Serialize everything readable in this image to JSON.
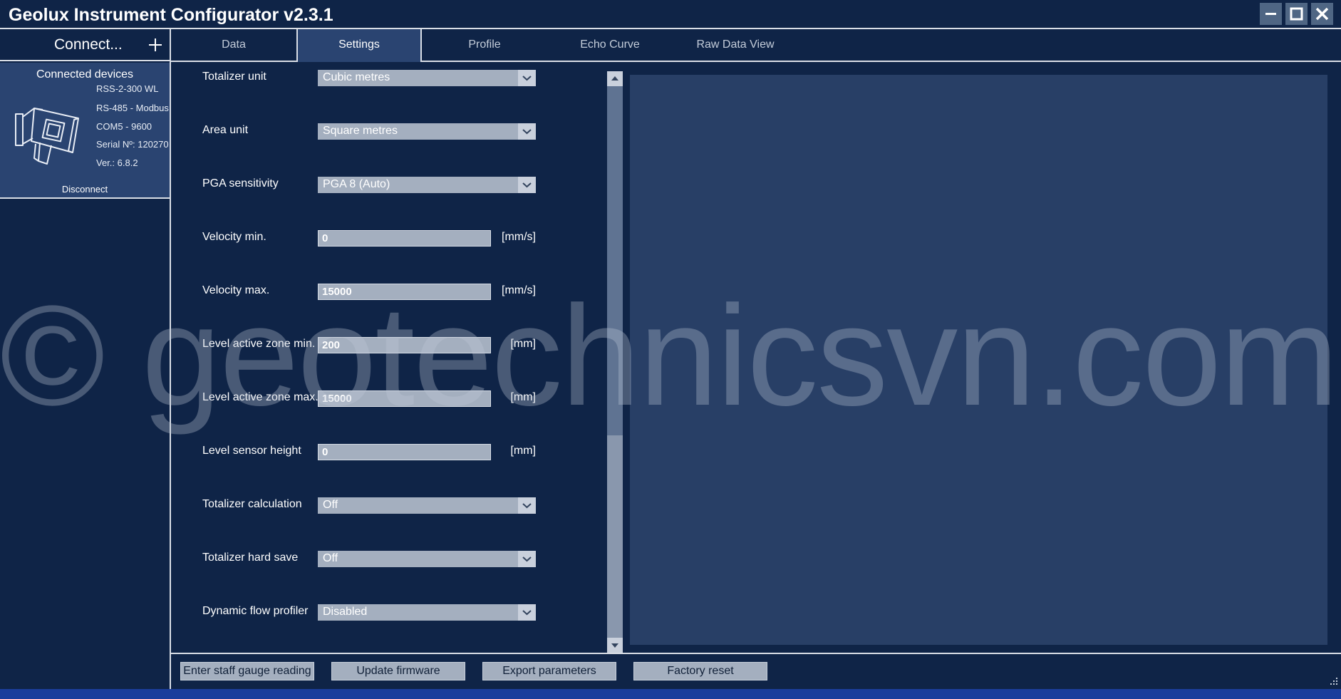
{
  "window": {
    "title": "Geolux Instrument Configurator v2.3.1",
    "controls": [
      "minimize-icon",
      "maximize-icon",
      "close-icon"
    ]
  },
  "sidebar": {
    "connect_label": "Connect...",
    "connected_devices_title": "Connected devices",
    "device": {
      "model": "RSS-2-300 WL",
      "protocol": "RS-485 - Modbus",
      "port": "COM5 - 9600",
      "serial": "Serial Nº: 120270",
      "version": "Ver.: 6.8.2"
    },
    "disconnect_label": "Disconnect"
  },
  "tabs": [
    {
      "label": "Data",
      "active": false
    },
    {
      "label": "Settings",
      "active": true
    },
    {
      "label": "Profile",
      "active": false
    },
    {
      "label": "Echo Curve",
      "active": false
    },
    {
      "label": "Raw Data View",
      "active": false
    }
  ],
  "settings": {
    "totalizer_unit": {
      "label": "Totalizer unit",
      "value": "Cubic metres"
    },
    "area_unit": {
      "label": "Area unit",
      "value": "Square metres"
    },
    "pga_sensitivity": {
      "label": "PGA sensitivity",
      "value": "PGA 8 (Auto)"
    },
    "velocity_min": {
      "label": "Velocity min.",
      "value": "0",
      "unit": "[mm/s]"
    },
    "velocity_max": {
      "label": "Velocity max.",
      "value": "15000",
      "unit": "[mm/s]"
    },
    "level_zone_min": {
      "label": "Level active zone min.",
      "value": "200",
      "unit": "[mm]"
    },
    "level_zone_max": {
      "label": "Level active zone max.",
      "value": "15000",
      "unit": "[mm]"
    },
    "level_sensor_height": {
      "label": "Level sensor height",
      "value": "0",
      "unit": "[mm]"
    },
    "totalizer_calculation": {
      "label": "Totalizer calculation",
      "value": "Off"
    },
    "totalizer_hard_save": {
      "label": "Totalizer hard save",
      "value": "Off"
    },
    "dynamic_flow_profiler": {
      "label": "Dynamic flow profiler",
      "value": "Disabled"
    }
  },
  "actions": {
    "staff_gauge": "Enter staff gauge reading",
    "update_firmware": "Update firmware",
    "export_parameters": "Export parameters",
    "factory_reset": "Factory reset"
  },
  "watermark": "© geotechnicsvn.com",
  "colors": {
    "background": "#0f2447",
    "panel": "#2a4471",
    "preview": "#283f66",
    "control": "#a4afbf",
    "border": "#d9dee6"
  }
}
